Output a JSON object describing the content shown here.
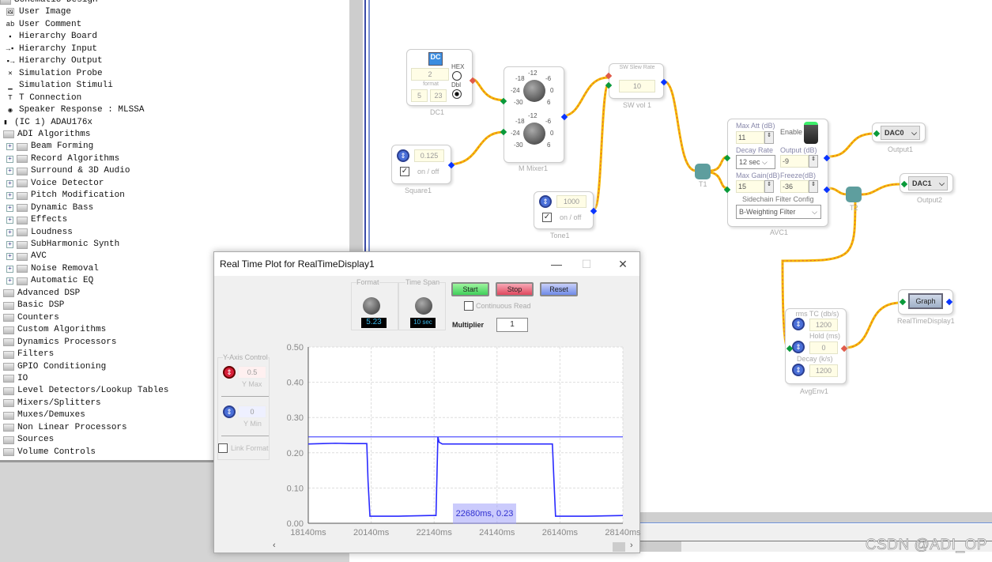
{
  "tree": {
    "items": [
      {
        "label": "Schematic Design",
        "level": 0,
        "icon": "folder-icon"
      },
      {
        "label": "User Image",
        "level": 1,
        "icon": "image-icon"
      },
      {
        "label": "User Comment",
        "level": 1,
        "icon": "comment-icon"
      },
      {
        "label": "Hierarchy Board",
        "level": 1,
        "icon": "hierarchy-board-icon"
      },
      {
        "label": "Hierarchy Input",
        "level": 1,
        "icon": "hierarchy-input-icon"
      },
      {
        "label": "Hierarchy Output",
        "level": 1,
        "icon": "hierarchy-output-icon"
      },
      {
        "label": "Simulation Probe",
        "level": 1,
        "icon": "probe-icon"
      },
      {
        "label": "Simulation Stimuli",
        "level": 1,
        "icon": "stimuli-icon"
      },
      {
        "label": "T Connection",
        "level": 1,
        "icon": "t-connection-icon"
      },
      {
        "label": "Speaker Response : MLSSA",
        "level": 1,
        "icon": "speaker-icon"
      },
      {
        "label": "(IC 1) ADAU176x",
        "level": 0,
        "icon": "chip-icon"
      },
      {
        "label": "ADI Algorithms",
        "level": 1,
        "icon": "folder-icon"
      },
      {
        "label": "Beam Forming",
        "level": 2,
        "icon": "folder-icon"
      },
      {
        "label": "Record Algorithms",
        "level": 2,
        "icon": "folder-icon"
      },
      {
        "label": "Surround & 3D Audio",
        "level": 2,
        "icon": "folder-icon"
      },
      {
        "label": "Voice Detector",
        "level": 2,
        "icon": "folder-icon"
      },
      {
        "label": "Pitch Modification",
        "level": 2,
        "icon": "folder-icon"
      },
      {
        "label": "Dynamic Bass",
        "level": 2,
        "icon": "folder-icon"
      },
      {
        "label": "Effects",
        "level": 2,
        "icon": "folder-icon"
      },
      {
        "label": "Loudness",
        "level": 2,
        "icon": "folder-icon"
      },
      {
        "label": "SubHarmonic Synth",
        "level": 2,
        "icon": "folder-icon"
      },
      {
        "label": "AVC",
        "level": 2,
        "icon": "folder-icon"
      },
      {
        "label": "Noise Removal",
        "level": 2,
        "icon": "folder-icon"
      },
      {
        "label": "Automatic EQ",
        "level": 2,
        "icon": "folder-icon"
      },
      {
        "label": "Advanced DSP",
        "level": 1,
        "icon": "folder-icon"
      },
      {
        "label": "Basic DSP",
        "level": 1,
        "icon": "folder-icon"
      },
      {
        "label": "Counters",
        "level": 1,
        "icon": "folder-icon"
      },
      {
        "label": "Custom Algorithms",
        "level": 1,
        "icon": "folder-icon"
      },
      {
        "label": "Dynamics Processors",
        "level": 1,
        "icon": "folder-icon"
      },
      {
        "label": "Filters",
        "level": 1,
        "icon": "folder-icon"
      },
      {
        "label": "GPIO Conditioning",
        "level": 1,
        "icon": "folder-icon"
      },
      {
        "label": "IO",
        "level": 1,
        "icon": "folder-icon"
      },
      {
        "label": "Level Detectors/Lookup Tables",
        "level": 1,
        "icon": "folder-icon"
      },
      {
        "label": "Mixers/Splitters",
        "level": 1,
        "icon": "folder-icon"
      },
      {
        "label": "Muxes/Demuxes",
        "level": 1,
        "icon": "folder-icon"
      },
      {
        "label": "Non Linear Processors",
        "level": 1,
        "icon": "folder-icon"
      },
      {
        "label": "Sources",
        "level": 1,
        "icon": "folder-icon"
      },
      {
        "label": "Volume Controls",
        "level": 1,
        "icon": "folder-icon"
      }
    ]
  },
  "schematic": {
    "dc1": {
      "name": "DC1",
      "icon_text": "DC",
      "value": "2",
      "format_label": "format",
      "format_a": "5",
      "format_b": "23",
      "hex_label": "HEX",
      "dbl_label": "Dbl",
      "selected": "Dbl"
    },
    "square1": {
      "name": "Square1",
      "value": "0.125",
      "toggle_label": "on / off",
      "checked": true
    },
    "mixer": {
      "name": "M Mixer1",
      "ticks": [
        "-12",
        "-18",
        "-6",
        "-24",
        "0",
        "-30",
        "6"
      ]
    },
    "swvol": {
      "name": "SW vol 1",
      "title": "SW Slew Rate",
      "value": "10"
    },
    "tone1": {
      "name": "Tone1",
      "value": "1000",
      "toggle_label": "on / off",
      "checked": true
    },
    "t1": {
      "name": "T1"
    },
    "t2": {
      "name": "T2"
    },
    "avc": {
      "name": "AVC1",
      "max_att_label": "Max Att (dB)",
      "max_att": "11",
      "enable_label": "Enable",
      "enabled": true,
      "decay_label": "Decay Rate",
      "decay": "12 sec",
      "output_label": "Output (dB)",
      "output": "-9",
      "max_gain_label": "Max Gain(dB)",
      "max_gain": "15",
      "freeze_label": "Freeze(dB)",
      "freeze": "-36",
      "sidechain_label": "Sidechain Filter Config",
      "sidechain": "B-Weighting Filter"
    },
    "output1": {
      "name": "Output1",
      "value": "DAC0"
    },
    "output2": {
      "name": "Output2",
      "value": "DAC1"
    },
    "avgenv": {
      "name": "AvgEnv1",
      "rms_label": "rms TC (db/s)",
      "rms": "1200",
      "hold_label": "Hold (ms)",
      "hold": "0",
      "decay_label": "Decay (k/s)",
      "decay": "1200"
    },
    "rtd": {
      "name": "RealTimeDisplay1",
      "button": "Graph"
    },
    "wire_color": "#f5b800"
  },
  "watermark": "CSDN @ADI_OP",
  "plot_window": {
    "title": "Real Time Plot for RealTimeDisplay1",
    "format_label": "Format",
    "format_value": "5.23",
    "timespan_label": "Time Span",
    "timespan_value": "10 sec",
    "start": "Start",
    "stop": "Stop",
    "reset": "Reset",
    "continuous_read": "Continuous Read",
    "continuous_checked": false,
    "multiplier_label": "Multiplier",
    "multiplier": "1",
    "yaxis_label": "Y-Axis Control",
    "ymax": "0.5",
    "ymax_label": "Y Max",
    "ymin": "0",
    "ymin_label": "Y Min",
    "link_format": "Link Format",
    "link_checked": false,
    "tooltip": "22680ms, 0.23"
  },
  "chart_data": {
    "type": "line",
    "xlim": [
      18140,
      28140
    ],
    "ylim": [
      0,
      0.5
    ],
    "xticks": [
      "18140ms",
      "20140ms",
      "22140ms",
      "24140ms",
      "26140ms",
      "28140ms"
    ],
    "yticks": [
      "0.00",
      "0.10",
      "0.20",
      "0.30",
      "0.40",
      "0.50"
    ],
    "grid": true,
    "color": "#2a2aff",
    "series": [
      {
        "x": [
          18140,
          18600,
          19000,
          19500,
          20000,
          20040,
          20100,
          21000,
          22000,
          22200,
          22260,
          22300,
          22400,
          23000,
          24000,
          25000,
          25900,
          25950,
          26000,
          27000,
          28140
        ],
        "y": [
          0.225,
          0.226,
          0.227,
          0.226,
          0.226,
          0.12,
          0.02,
          0.02,
          0.022,
          0.022,
          0.245,
          0.23,
          0.225,
          0.225,
          0.225,
          0.225,
          0.225,
          0.12,
          0.02,
          0.02,
          0.022
        ]
      },
      {
        "x": [
          18140,
          28140
        ],
        "y": [
          0.245,
          0.245
        ]
      }
    ]
  }
}
